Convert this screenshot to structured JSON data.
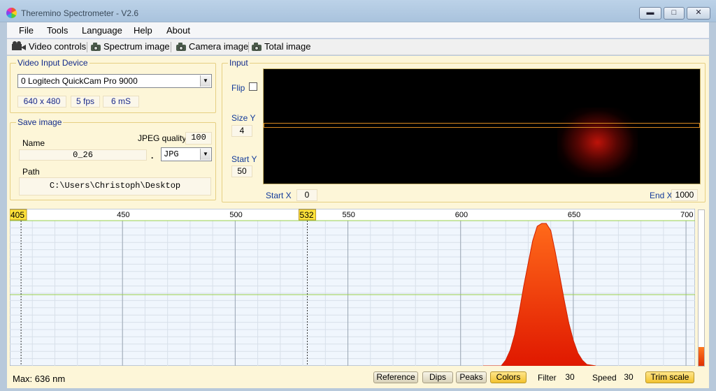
{
  "window": {
    "title": "Theremino Spectrometer - V2.6",
    "min_glyph": "▬",
    "max_glyph": "□",
    "close_glyph": "✕"
  },
  "menu": [
    "File",
    "Tools",
    "Language",
    "Help",
    "About"
  ],
  "toolbar": {
    "video_controls": "Video controls",
    "spectrum_image": "Spectrum image",
    "camera_image": "Camera image",
    "total_image": "Total image"
  },
  "video_input": {
    "title": "Video Input Device",
    "device": "0 Logitech QuickCam Pro 9000",
    "resolution": "640 x 480",
    "fps": "5 fps",
    "exposure": "6 mS"
  },
  "save_image": {
    "title": "Save image",
    "name_label": "Name",
    "name_value": "0_26",
    "jpeg_quality_label": "JPEG quality",
    "jpeg_quality_value": "100",
    "dot": ".",
    "format": "JPG",
    "path_label": "Path",
    "path_value": "C:\\Users\\Christoph\\Desktop"
  },
  "input": {
    "title": "Input",
    "flip_label": "Flip",
    "flip_checked": false,
    "size_y_label": "Size Y",
    "size_y_value": "4",
    "start_y_label": "Start Y",
    "start_y_value": "50",
    "start_x_label": "Start X",
    "start_x_value": "0",
    "end_x_label": "End X",
    "end_x_value": "1000"
  },
  "status": {
    "max_text": "Max: 636 nm",
    "buttons": [
      "Reference",
      "Dips",
      "Peaks",
      "Colors"
    ],
    "active_button": "Colors",
    "filter_label": "Filter",
    "filter_value": "30",
    "speed_label": "Speed",
    "speed_value": "30",
    "trim_scale": "Trim scale",
    "level_fraction": 0.12
  },
  "chart_data": {
    "type": "area",
    "xlim": [
      400,
      704
    ],
    "x_ticks": [
      450,
      500,
      550,
      600,
      650,
      700
    ],
    "tick_labels": [
      "450",
      "500",
      "550",
      "600",
      "650",
      "700"
    ],
    "markers": [
      {
        "label": "405",
        "x": 405
      },
      {
        "label": "532",
        "x": 532
      }
    ],
    "ylim": [
      0,
      100
    ],
    "reference_line": 50,
    "colors": {
      "line": "#d02000",
      "fill_top": "#ff6a1a",
      "fill_bottom": "#e01800",
      "grid": "#d8e0ea",
      "ref": "#9ad04a"
    },
    "x": [
      610,
      618,
      620,
      622,
      624,
      626,
      628,
      630,
      632,
      634,
      636,
      638,
      640,
      642,
      644,
      646,
      648,
      650,
      652,
      654,
      656,
      660
    ],
    "values": [
      0,
      0,
      4,
      11,
      22,
      38,
      56,
      72,
      88,
      98,
      100,
      100,
      95,
      80,
      63,
      46,
      30,
      18,
      9,
      4,
      1,
      0
    ]
  }
}
